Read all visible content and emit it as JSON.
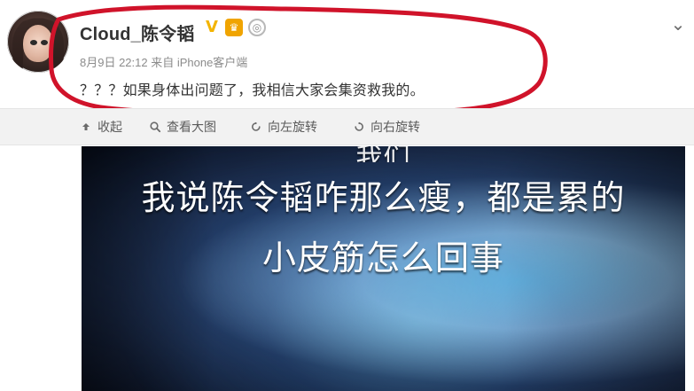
{
  "post": {
    "username": "Cloud_陈令韬",
    "meta": "8月9日 22:12 来自 iPhone客户端",
    "text": "？？？如果身体出问题了，我相信大家会集资救我的。"
  },
  "badges": {
    "verified": "V",
    "crown": "♛",
    "medal": "◎"
  },
  "toolbar": {
    "collapse_label": "收起",
    "view_full_label": "查看大图",
    "rotate_left_label": "向左旋转",
    "rotate_right_label": "向右旋转"
  },
  "image": {
    "caption_top_partial": "…我们…",
    "caption_line_1": "我说陈令韬咋那么瘦，都是累的",
    "caption_line_2": "小皮筋怎么回事"
  },
  "colors": {
    "annotation_red": "#d0132a",
    "toolbar_bg": "#f2f2f2",
    "text_primary": "#333333",
    "text_meta": "#8c8c8c",
    "verified_gold": "#f3b400",
    "crown_orange": "#f0a400"
  },
  "icons": {
    "chevron": "chevron-down-icon",
    "collapse": "collapse-icon",
    "view_full": "search-icon",
    "rotate_left": "rotate-left-icon",
    "rotate_right": "rotate-right-icon"
  }
}
